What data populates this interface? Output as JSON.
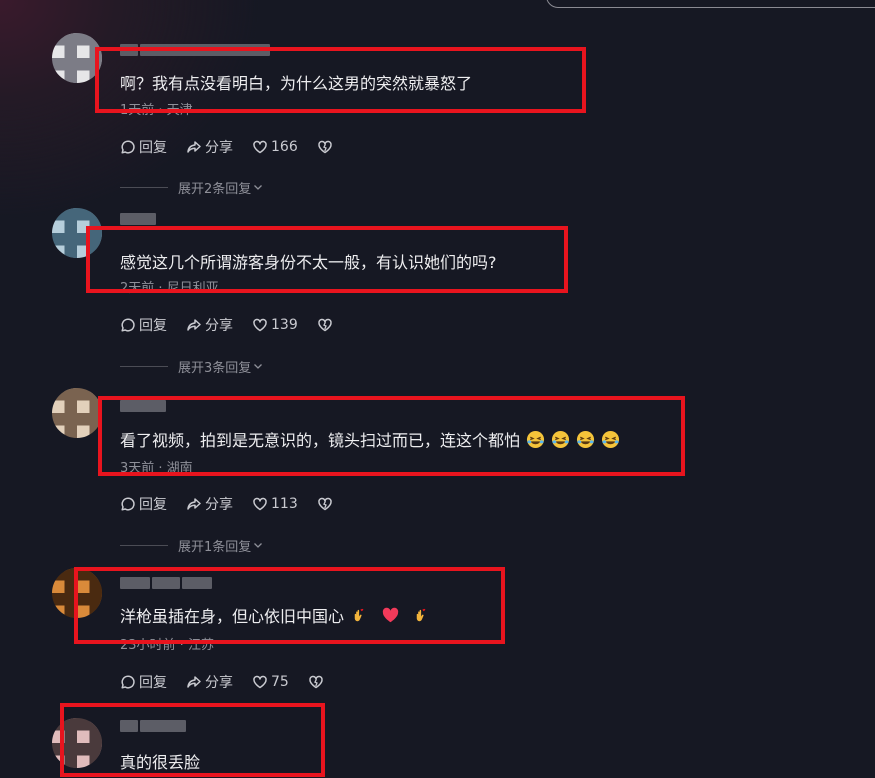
{
  "comments": [
    {
      "avatar_colors": [
        "#d6d6d8",
        "#9a9aa2",
        "#e6e6e8",
        "#7c7c86"
      ],
      "username_hidden": true,
      "text": "啊？我有点没看明白，为什么这男的突然就暴怒了",
      "meta": "1天前 · 天津",
      "reply_label": "回复",
      "share_label": "分享",
      "likes": "166",
      "expand_label": "展开2条回复"
    },
    {
      "avatar_colors": [
        "#8fb2c8",
        "#5d7f95",
        "#b6cedb",
        "#45667a"
      ],
      "username_hidden": true,
      "text": "感觉这几个所谓游客身份不太一般，有认识她们的吗?",
      "meta": "2天前 · 尼日利亚",
      "reply_label": "回复",
      "share_label": "分享",
      "likes": "139",
      "expand_label": "展开3条回复"
    },
    {
      "avatar_colors": [
        "#c9b39a",
        "#3c3026",
        "#e2d0bb",
        "#7a6350"
      ],
      "username_hidden": true,
      "text": "看了视频，拍到是无意识的，镜头扫过而已，连这个都怕",
      "emoji": [
        "laugh",
        "laugh",
        "laugh",
        "laugh"
      ],
      "meta": "3天前 · 湖南",
      "reply_label": "回复",
      "share_label": "分享",
      "likes": "113",
      "expand_label": "展开1条回复"
    },
    {
      "avatar_colors": [
        "#b4641e",
        "#6e3a12",
        "#d98a3a",
        "#4a2a10"
      ],
      "username_hidden": true,
      "text": "洋枪虽插在身，但心依旧中国心",
      "emoji": [
        "fingers",
        "heart",
        "fingers"
      ],
      "meta": "23小时前 · 江苏",
      "reply_label": "回复",
      "share_label": "分享",
      "likes": "75"
    },
    {
      "avatar_colors": [
        "#c99a9a",
        "#6a4a4c",
        "#e0bcbc",
        "#4a3a3c"
      ],
      "username_hidden": true,
      "text": "真的很丢脸"
    }
  ],
  "icons": {
    "reply": "comment-bubble-icon",
    "share": "share-arrow-icon",
    "like": "heart-outline-icon",
    "dislike": "broken-heart-icon",
    "expand": "chevron-down-icon"
  },
  "colors": {
    "background": "#161823",
    "highlight": "#e8141e",
    "meta": "#8f9099"
  }
}
